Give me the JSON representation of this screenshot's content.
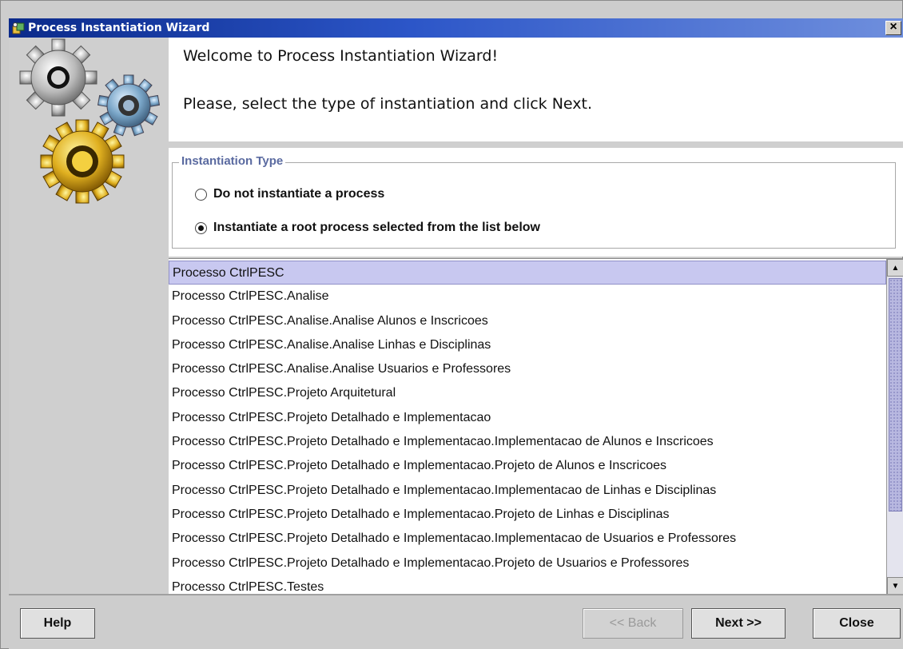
{
  "window": {
    "title": "Process Instantiation Wizard",
    "close_glyph": "×"
  },
  "icons": {
    "app": "wizard-app-icon",
    "gears": "gears-icon"
  },
  "welcome": {
    "line1": "Welcome to Process Instantiation Wizard!",
    "line2": "Please, select the type of instantiation and click Next."
  },
  "instantiation": {
    "group_title": "Instantiation Type",
    "options": [
      {
        "label": "Do not instantiate a process",
        "checked": false
      },
      {
        "label": "Instantiate a root process selected from the list below",
        "checked": true
      }
    ]
  },
  "process_list": {
    "selected_index": 0,
    "items": [
      "Processo CtrlPESC",
      "Processo CtrlPESC.Analise",
      "Processo CtrlPESC.Analise.Analise Alunos e Inscricoes",
      "Processo CtrlPESC.Analise.Analise Linhas e Disciplinas",
      "Processo CtrlPESC.Analise.Analise Usuarios e Professores",
      "Processo CtrlPESC.Projeto Arquitetural",
      "Processo CtrlPESC.Projeto Detalhado e Implementacao",
      "Processo CtrlPESC.Projeto Detalhado e Implementacao.Implementacao de Alunos e Inscricoes",
      "Processo CtrlPESC.Projeto Detalhado e Implementacao.Projeto de Alunos e Inscricoes",
      "Processo CtrlPESC.Projeto Detalhado e Implementacao.Implementacao de Linhas e Disciplinas",
      "Processo CtrlPESC.Projeto Detalhado e Implementacao.Projeto de Linhas e Disciplinas",
      "Processo CtrlPESC.Projeto Detalhado e Implementacao.Implementacao de Usuarios e Professores",
      "Processo CtrlPESC.Projeto Detalhado e Implementacao.Projeto de Usuarios e Professores",
      "Processo CtrlPESC.Testes"
    ]
  },
  "buttons": {
    "help": "Help",
    "back": "<< Back",
    "next": "Next >>",
    "close": "Close"
  },
  "colors": {
    "title_gradient_start": "#0b2a8a",
    "title_gradient_end": "#6f8fdd",
    "selection": "#c8c8f0",
    "group_title": "#5a6aa0"
  }
}
